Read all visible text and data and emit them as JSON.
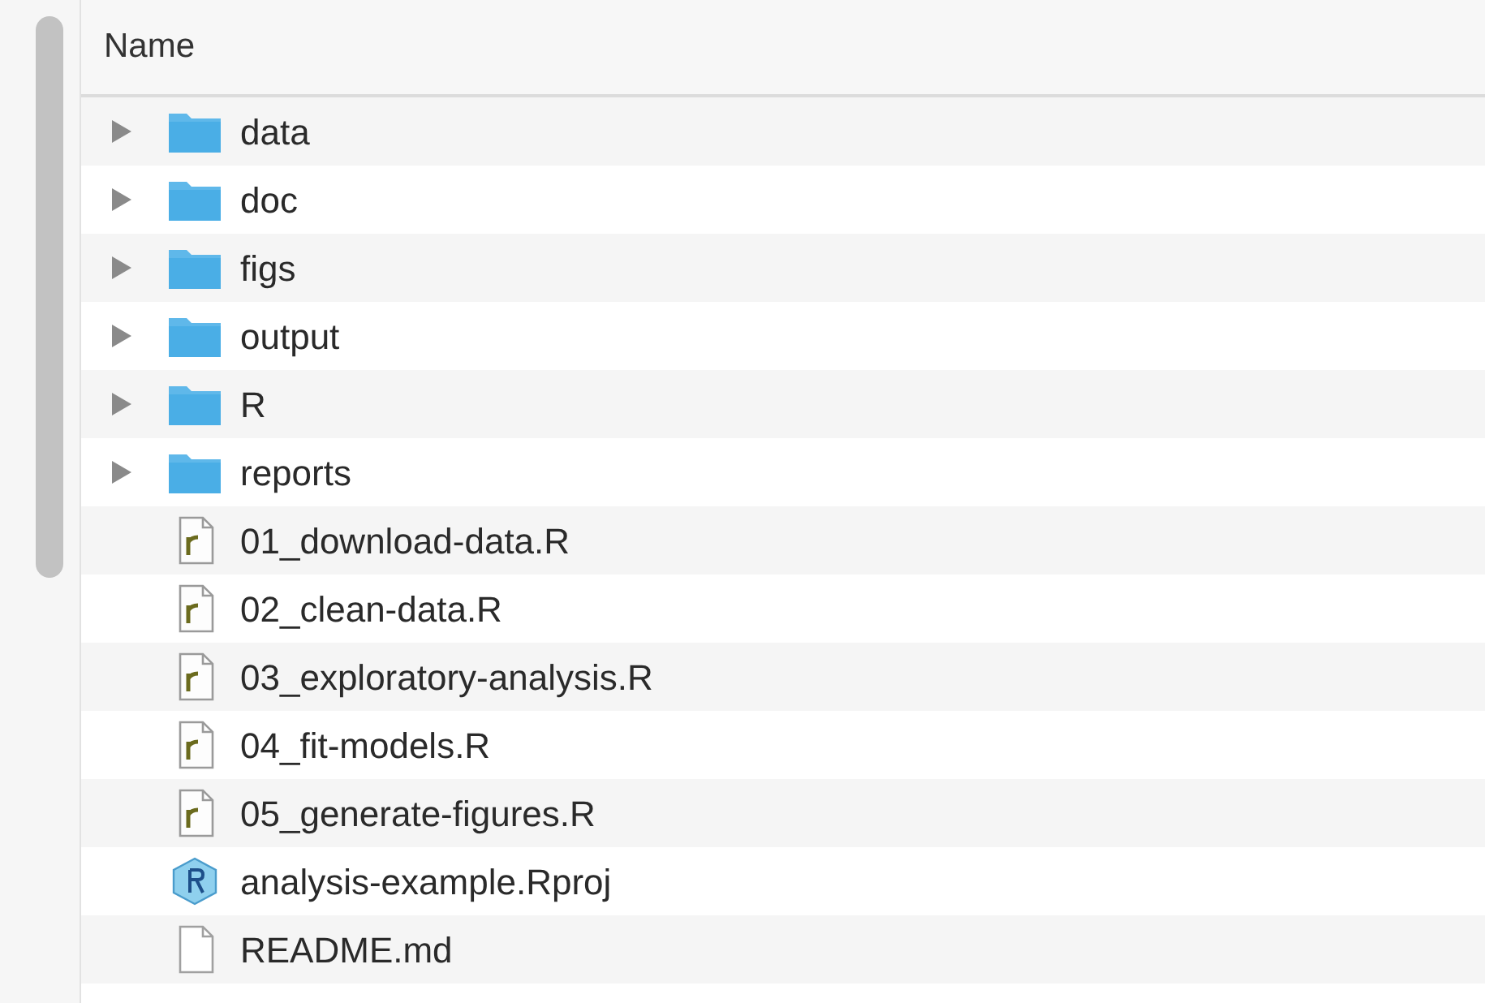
{
  "columns": [
    {
      "label": "Name"
    }
  ],
  "rows": [
    {
      "name": "data",
      "kind": "folder",
      "expanded": false
    },
    {
      "name": "doc",
      "kind": "folder",
      "expanded": false
    },
    {
      "name": "figs",
      "kind": "folder",
      "expanded": false
    },
    {
      "name": "output",
      "kind": "folder",
      "expanded": false
    },
    {
      "name": "R",
      "kind": "folder",
      "expanded": false
    },
    {
      "name": "reports",
      "kind": "folder",
      "expanded": false
    },
    {
      "name": "01_download-data.R",
      "kind": "rscript"
    },
    {
      "name": "02_clean-data.R",
      "kind": "rscript"
    },
    {
      "name": "03_exploratory-analysis.R",
      "kind": "rscript"
    },
    {
      "name": "04_fit-models.R",
      "kind": "rscript"
    },
    {
      "name": "05_generate-figures.R",
      "kind": "rscript"
    },
    {
      "name": "analysis-example.Rproj",
      "kind": "rproj"
    },
    {
      "name": "README.md",
      "kind": "document"
    }
  ]
}
